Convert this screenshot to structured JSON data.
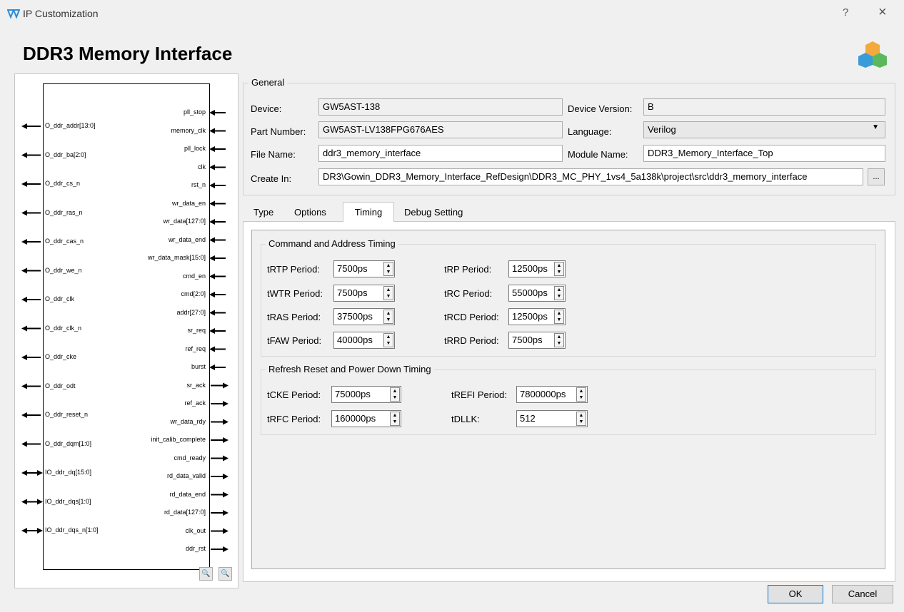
{
  "window": {
    "app_title": "IP Customization",
    "help": "?",
    "close": "×",
    "main_title": "DDR3 Memory Interface"
  },
  "diagram": {
    "left_pins": [
      "O_ddr_addr[13:0]",
      "O_ddr_ba[2:0]",
      "O_ddr_cs_n",
      "O_ddr_ras_n",
      "O_ddr_cas_n",
      "O_ddr_we_n",
      "O_ddr_clk",
      "O_ddr_clk_n",
      "O_ddr_cke",
      "O_ddr_odt",
      "O_ddr_reset_n",
      "O_ddr_dqm[1:0]",
      "IO_ddr_dq[15:0]",
      "IO_ddr_dqs[1:0]",
      "IO_ddr_dqs_n[1:0]"
    ],
    "right_pins": [
      "pll_stop",
      "memory_clk",
      "pll_lock",
      "clk",
      "rst_n",
      "wr_data_en",
      "wr_data[127:0]",
      "wr_data_end",
      "wr_data_mask[15:0]",
      "cmd_en",
      "cmd[2:0]",
      "addr[27:0]",
      "sr_req",
      "ref_req",
      "burst",
      "sr_ack",
      "ref_ack",
      "wr_data_rdy",
      "init_calib_complete",
      "cmd_ready",
      "rd_data_valid",
      "rd_data_end",
      "rd_data[127:0]",
      "clk_out",
      "ddr_rst"
    ],
    "zoom_in": "🔍",
    "zoom_out": "🔍"
  },
  "general": {
    "title": "General",
    "device_label": "Device:",
    "device_value": "GW5AST-138",
    "device_version_label": "Device Version:",
    "device_version_value": "B",
    "part_number_label": "Part Number:",
    "part_number_value": "GW5AST-LV138FPG676AES",
    "language_label": "Language:",
    "language_value": "Verilog",
    "file_name_label": "File Name:",
    "file_name_value": "ddr3_memory_interface",
    "module_name_label": "Module Name:",
    "module_name_value": "DDR3_Memory_Interface_Top",
    "create_in_label": "Create In:",
    "create_in_value": "DR3\\Gowin_DDR3_Memory_Interface_RefDesign\\DDR3_MC_PHY_1vs4_5a138k\\project\\src\\ddr3_memory_interface",
    "browse": "..."
  },
  "tabs": [
    "Type",
    "Options",
    "Timing",
    "Debug Setting"
  ],
  "timing": {
    "cmd_group_title": "Command and Address Timing",
    "cmd_fields": [
      {
        "label": "tRTP Period:",
        "value": "7500ps"
      },
      {
        "label": "tWTR Period:",
        "value": "7500ps"
      },
      {
        "label": "tRAS Period:",
        "value": "37500ps"
      },
      {
        "label": "tFAW Period:",
        "value": "40000ps"
      },
      {
        "label": "tRP Period:",
        "value": "12500ps"
      },
      {
        "label": "tRC Period:",
        "value": "55000ps"
      },
      {
        "label": "tRCD Period:",
        "value": "12500ps"
      },
      {
        "label": "tRRD Period:",
        "value": "7500ps"
      }
    ],
    "refresh_group_title": "Refresh Reset and Power Down Timing",
    "refresh_fields": [
      {
        "label": "tCKE Period:",
        "value": "75000ps"
      },
      {
        "label": "tRFC Period:",
        "value": "160000ps"
      },
      {
        "label": "tREFI Period:",
        "value": "7800000ps"
      },
      {
        "label": "tDLLK:",
        "value": "512"
      }
    ]
  },
  "buttons": {
    "ok": "OK",
    "cancel": "Cancel"
  }
}
